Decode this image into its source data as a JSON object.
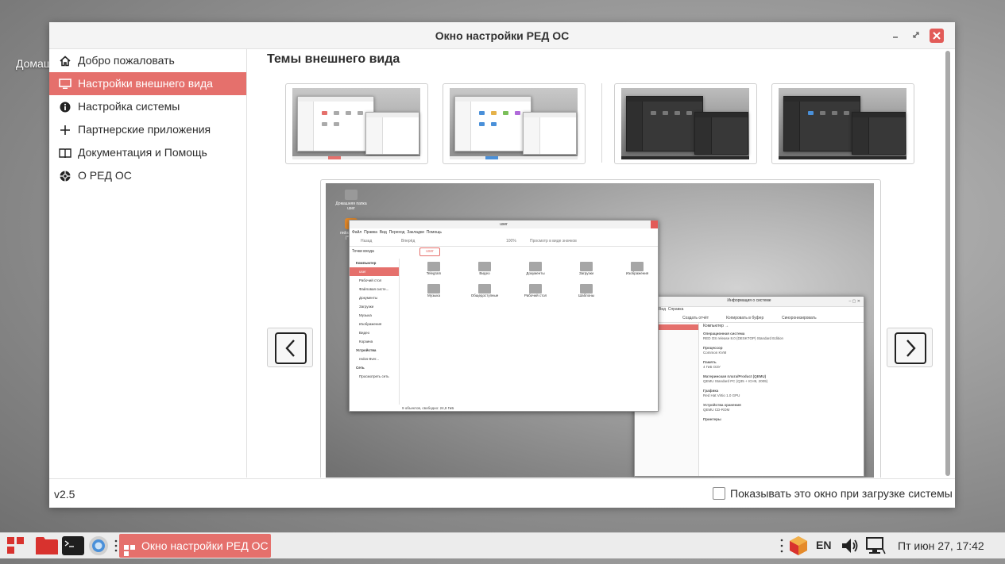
{
  "desktop": {
    "icon_label": "Домаш"
  },
  "window": {
    "title": "Окно настройки РЕД ОС",
    "controls": {
      "minimize_icon": "minimize-icon",
      "maximize_icon": "maximize-icon",
      "close_icon": "close-icon"
    }
  },
  "sidebar": {
    "items": [
      {
        "label": "Добро пожаловать",
        "icon": "home-icon",
        "active": false
      },
      {
        "label": "Настройки внешнего вида",
        "icon": "monitor-icon",
        "active": true
      },
      {
        "label": "Настройка системы",
        "icon": "info-icon",
        "active": false
      },
      {
        "label": "Партнерские приложения",
        "icon": "plus-icon",
        "active": false
      },
      {
        "label": "Документация и Помощь",
        "icon": "book-icon",
        "active": false
      },
      {
        "label": "О РЕД ОС",
        "icon": "lifebuoy-icon",
        "active": false
      }
    ]
  },
  "main": {
    "heading": "Темы внешнего вида",
    "themes": [
      {
        "name": "light-theme-1",
        "style": "light",
        "accent": "#e5706c"
      },
      {
        "name": "light-theme-2",
        "style": "light",
        "accent": "#4a90d9"
      },
      {
        "name": "dark-theme-1",
        "style": "dark",
        "accent": "#e5706c"
      },
      {
        "name": "dark-theme-2",
        "style": "dark",
        "accent": "#4a90d9"
      }
    ],
    "preview": {
      "fm_title": "user",
      "fm_menu": [
        "Файл",
        "Правка",
        "Вид",
        "Переход",
        "Закладки",
        "Помощь"
      ],
      "fm_back": "Назад",
      "fm_forward": "Вперёд",
      "fm_zoom": "100%",
      "fm_view_mode": "Просмотр в виде значков",
      "fm_side_mode": "Точки входа",
      "fm_path": "user",
      "fm_sections": {
        "computer": "Компьютер",
        "devices": "Устройства",
        "network": "Сеть"
      },
      "fm_places": [
        "user",
        "Рабочий стол",
        "Файловая систе...",
        "Документы",
        "Загрузки",
        "Музыка",
        "Изображения",
        "Видео",
        "Корзина"
      ],
      "fm_devices": [
        "redos-8ver..."
      ],
      "fm_network": [
        "Просмотреть сеть"
      ],
      "fm_folders": [
        "Telegram",
        "Видео",
        "Документы",
        "Загрузки",
        "Изображения",
        "Музыка",
        "Общедоступные",
        "Рабочий стол",
        "Шаблоны"
      ],
      "fm_status": "9 объектов, свободно: 24,8 ГиБ",
      "sysinfo_title": "Информация о системе",
      "sysinfo_menu": [
        "Вид",
        "Справка"
      ],
      "sysinfo_toolbar": [
        "Создать отчёт",
        "Копировать в буфер",
        "Синхронизировать"
      ],
      "sysinfo_tree_header": "Компьютер →",
      "sysinfo_sections": [
        {
          "title": "Операционная система",
          "value": "RED OS release 8.0 (DESKTOP) Standard Edition"
        },
        {
          "title": "Процессор",
          "value": "Common KVM"
        },
        {
          "title": "Память",
          "value": "4 ГиБ ОЗУ"
        },
        {
          "title": "Материнская плата/Product (QEMU)",
          "value": "QEMU Standard PC (Q35 + ICH9, 2009)"
        },
        {
          "title": "Графика",
          "value": "Red Hat Virtio 1.0 GPU"
        },
        {
          "title": "Устройства хранения",
          "value": "QEMU CD-ROM"
        },
        {
          "title": "Принтеры",
          "value": ""
        }
      ],
      "desktop_icons": [
        "Домашняя папка user",
        "redos-8ver... (*VC..."
      ]
    },
    "prev_icon": "chevron-left-icon",
    "next_icon": "chevron-right-icon"
  },
  "footer": {
    "version": "v2.5",
    "startup_label": "Показывать это окно при загрузке системы",
    "startup_checked": false
  },
  "taskbar": {
    "task_label": "Окно настройки РЕД ОС",
    "lang": "EN",
    "clock": "Пт июн 27, 17:42"
  }
}
